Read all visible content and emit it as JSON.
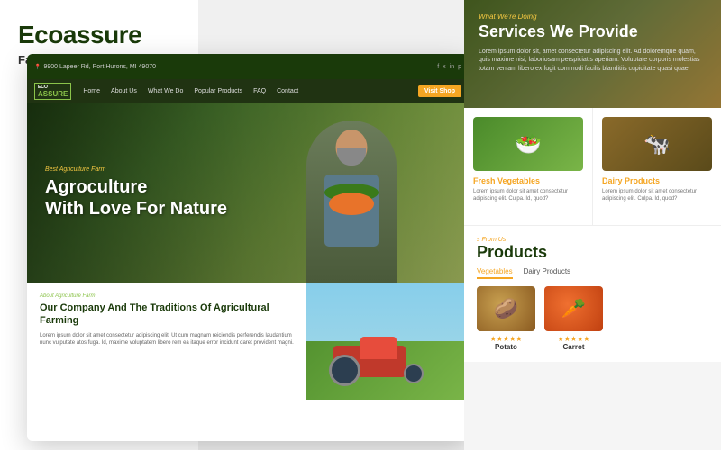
{
  "brand": {
    "name": "Ecoassure",
    "tagline": "Farming and Agriculture"
  },
  "nav": {
    "address": "9900 Lapeer Rd, Port Hurons, MI 49070",
    "menu_items": [
      "Home",
      "About Us",
      "What We Do",
      "Popular Products",
      "FAQ",
      "Contact"
    ],
    "logo_line1": "ECO",
    "logo_line2": "ASSURE",
    "visit_shop": "Visit Shop",
    "social_icons": [
      "f",
      "x",
      "in",
      "p"
    ]
  },
  "hero": {
    "small_text": "Best Agriculture Farm",
    "title_line1": "Agroculture",
    "title_line2": "With Love For Nature"
  },
  "about": {
    "small_text": "About Agriculture Farm",
    "title": "Our Company And The Traditions Of Agricultural Farming",
    "body": "Lorem ipsum dolor sit amet consectetur adipiscing elit. Ut cum magnam reiciendis perferendis laudantium nunc vulputate atos fuga. Id, maxime voluptatem libero rem ea itaque error incidunt daret provident magni."
  },
  "services": {
    "small_text": "What We're Doing",
    "title": "Services We Provide",
    "description": "Lorem ipsum dolor sit, amet consectetur adipiscing elit. Ad doloremque quam, quis maxime nisi, laboriosam perspiciatis aperiam. Voluptate corporis molestias totam veniam libero ex fugit commodi facilis blanditiis cupiditate quasi quae."
  },
  "product_cards": [
    {
      "name": "Fresh Vegetables",
      "desc": "Lorem ipsum dolor sit amet consectetur adipiscing elit. Culpa. Id, quod?",
      "icon": "🥗"
    },
    {
      "name": "Dairy Products",
      "desc": "Lorem ipsum dolor sit amet consectetur adipiscing elit. Culpa. Id, quod?",
      "icon": "🐄"
    }
  ],
  "products_section": {
    "small_text": "s From Us",
    "title": "Products",
    "tabs": [
      "Vegetables",
      "Dairy Products"
    ],
    "active_tab": "Vegetables",
    "items": [
      {
        "name": "Potato",
        "icon": "🥔",
        "stars": "★★★★★"
      },
      {
        "name": "Carrot",
        "icon": "🥕",
        "stars": "★★★★★"
      }
    ]
  }
}
